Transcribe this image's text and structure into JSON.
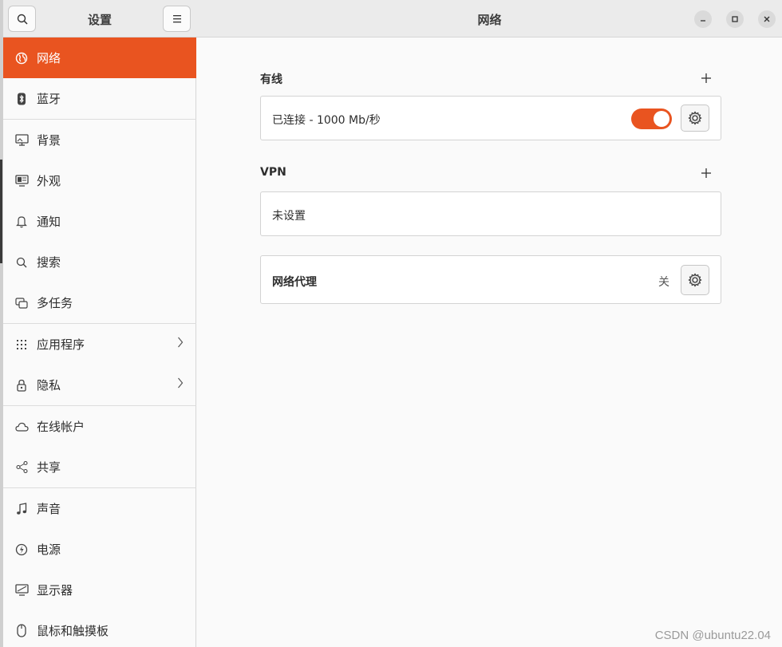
{
  "sidebar": {
    "title": "设置",
    "search_icon": "search-icon",
    "menu_icon": "hamburger-menu-icon",
    "items": [
      {
        "label": "网络",
        "icon": "globe-icon",
        "active": true
      },
      {
        "label": "蓝牙",
        "icon": "bluetooth-icon"
      },
      {
        "label": "背景",
        "icon": "monitor-icon"
      },
      {
        "label": "外观",
        "icon": "appearance-icon"
      },
      {
        "label": "通知",
        "icon": "bell-icon"
      },
      {
        "label": "搜索",
        "icon": "search-icon"
      },
      {
        "label": "多任务",
        "icon": "multitask-icon"
      },
      {
        "label": "应用程序",
        "icon": "apps-grid-icon",
        "chevron": true
      },
      {
        "label": "隐私",
        "icon": "lock-icon",
        "chevron": true
      },
      {
        "label": "在线帐户",
        "icon": "cloud-icon"
      },
      {
        "label": "共享",
        "icon": "share-icon"
      },
      {
        "label": "声音",
        "icon": "music-note-icon"
      },
      {
        "label": "电源",
        "icon": "power-icon"
      },
      {
        "label": "显示器",
        "icon": "display-icon"
      },
      {
        "label": "鼠标和触摸板",
        "icon": "mouse-icon"
      }
    ]
  },
  "header": {
    "title": "网络",
    "minimize_icon": "minimize-icon",
    "maximize_icon": "maximize-icon",
    "close_icon": "close-icon"
  },
  "wired": {
    "section_title": "有线",
    "status": "已连接 - 1000 Mb/秒",
    "toggle_on": true
  },
  "vpn": {
    "section_title": "VPN",
    "status": "未设置"
  },
  "proxy": {
    "label": "网络代理",
    "state": "关"
  },
  "watermark": "CSDN @ubuntu22.04",
  "colors": {
    "accent": "#e95420",
    "header_bg": "#ebebeb"
  }
}
